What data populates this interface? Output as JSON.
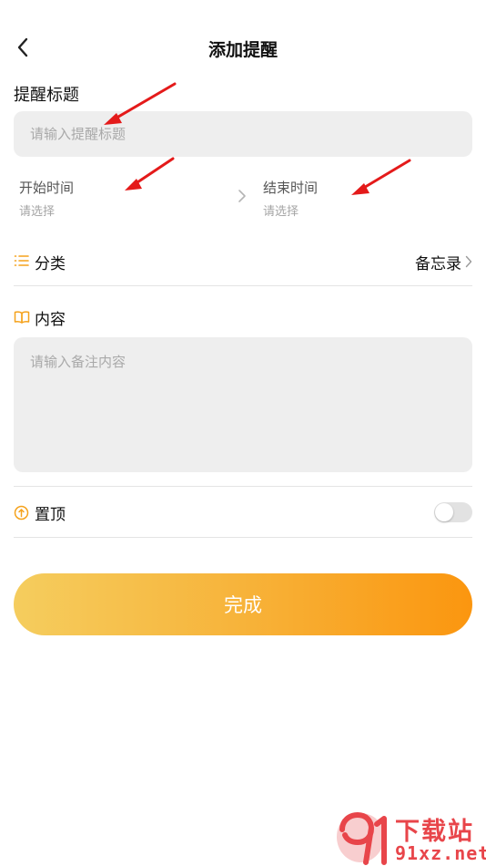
{
  "header": {
    "title": "添加提醒"
  },
  "form": {
    "title_label": "提醒标题",
    "title_placeholder": "请输入提醒标题",
    "start_time": {
      "label": "开始时间",
      "value": "请选择"
    },
    "end_time": {
      "label": "结束时间",
      "value": "请选择"
    },
    "category": {
      "label": "分类",
      "value": "备忘录"
    },
    "content": {
      "label": "内容",
      "placeholder": "请输入备注内容"
    },
    "pin": {
      "label": "置顶",
      "enabled": false
    },
    "submit_label": "完成"
  },
  "colors": {
    "accent": "#fb960f",
    "gradient_start": "#f5cd5e",
    "input_bg": "#eeeeee",
    "annotation_arrow": "#e41a1a"
  },
  "icons": {
    "back": "chevron-left-icon",
    "category": "list-icon",
    "content": "book-icon",
    "pin": "pin-circle-icon"
  },
  "watermark": {
    "brand": "下载站",
    "url": "91xz.net"
  }
}
